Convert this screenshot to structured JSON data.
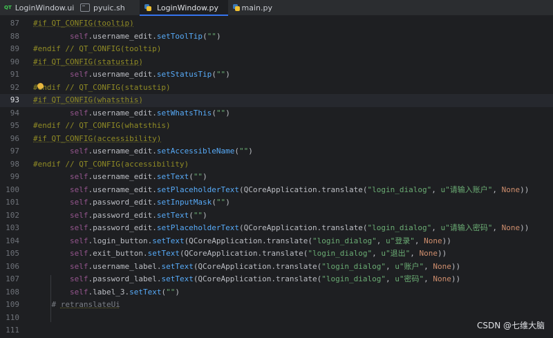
{
  "tabs": [
    {
      "label": "LoginWindow.ui",
      "icon": "qt-ui-icon",
      "icon_text": "QT",
      "active": false
    },
    {
      "label": "pyuic.sh",
      "icon": "shell-script-icon",
      "active": false
    },
    {
      "label": "LoginWindow.py",
      "icon": "python-file-icon",
      "active": true
    },
    {
      "label": "main.py",
      "icon": "python-file-icon",
      "active": false
    }
  ],
  "current_line": "93",
  "lines": [
    {
      "n": "87",
      "tokens": [
        [
          "pps",
          "#if QT_CONFIG(tooltip)"
        ]
      ]
    },
    {
      "n": "88",
      "tokens": [
        [
          "t",
          "        "
        ],
        [
          "kw",
          "self"
        ],
        [
          "t",
          ".username_edit."
        ],
        [
          "fn",
          "setToolTip"
        ],
        [
          "t",
          "("
        ],
        [
          "str",
          "\"\""
        ],
        [
          "t",
          ")"
        ]
      ]
    },
    {
      "n": "89",
      "tokens": [
        [
          "pp",
          "#endif // QT_CONFIG(tooltip)"
        ]
      ]
    },
    {
      "n": "90",
      "tokens": [
        [
          "pps",
          "#if QT_CONFIG(statustip)"
        ]
      ]
    },
    {
      "n": "91",
      "tokens": [
        [
          "t",
          "        "
        ],
        [
          "kw",
          "self"
        ],
        [
          "t",
          ".username_edit."
        ],
        [
          "fn",
          "setStatusTip"
        ],
        [
          "t",
          "("
        ],
        [
          "str",
          "\"\""
        ],
        [
          "t",
          ")"
        ]
      ]
    },
    {
      "n": "92",
      "tokens": [
        [
          "pp",
          "#endif // QT_CONFIG(statustip)"
        ]
      ]
    },
    {
      "n": "93",
      "tokens": [
        [
          "pps",
          "#if QT_CONFIG(whatsthis)"
        ]
      ]
    },
    {
      "n": "94",
      "tokens": [
        [
          "t",
          "        "
        ],
        [
          "kw",
          "self"
        ],
        [
          "t",
          ".username_edit."
        ],
        [
          "fn",
          "setWhatsThis"
        ],
        [
          "t",
          "("
        ],
        [
          "str",
          "\"\""
        ],
        [
          "t",
          ")"
        ]
      ]
    },
    {
      "n": "95",
      "tokens": [
        [
          "pp",
          "#endif // QT_CONFIG(whatsthis)"
        ]
      ]
    },
    {
      "n": "96",
      "tokens": [
        [
          "pps",
          "#if QT_CONFIG(accessibility)"
        ]
      ]
    },
    {
      "n": "97",
      "tokens": [
        [
          "t",
          "        "
        ],
        [
          "kw",
          "self"
        ],
        [
          "t",
          ".username_edit."
        ],
        [
          "fn",
          "setAccessibleName"
        ],
        [
          "t",
          "("
        ],
        [
          "str",
          "\"\""
        ],
        [
          "t",
          ")"
        ]
      ]
    },
    {
      "n": "98",
      "tokens": [
        [
          "pp",
          "#endif // QT_CONFIG(accessibility)"
        ]
      ]
    },
    {
      "n": "99",
      "tokens": [
        [
          "t",
          "        "
        ],
        [
          "kw",
          "self"
        ],
        [
          "t",
          ".username_edit."
        ],
        [
          "fn",
          "setText"
        ],
        [
          "t",
          "("
        ],
        [
          "str",
          "\"\""
        ],
        [
          "t",
          ")"
        ]
      ]
    },
    {
      "n": "100",
      "tokens": [
        [
          "t",
          "        "
        ],
        [
          "kw",
          "self"
        ],
        [
          "t",
          ".username_edit."
        ],
        [
          "fn",
          "setPlaceholderText"
        ],
        [
          "t",
          "(QCoreApplication.translate("
        ],
        [
          "str",
          "\"login_dialog\""
        ],
        [
          "t",
          ", "
        ],
        [
          "str",
          "u\"请输入账户\""
        ],
        [
          "t",
          ", "
        ],
        [
          "none",
          "None"
        ],
        [
          "t",
          "))"
        ]
      ]
    },
    {
      "n": "101",
      "tokens": [
        [
          "t",
          "        "
        ],
        [
          "kw",
          "self"
        ],
        [
          "t",
          ".password_edit."
        ],
        [
          "fn",
          "setInputMask"
        ],
        [
          "t",
          "("
        ],
        [
          "str",
          "\"\""
        ],
        [
          "t",
          ")"
        ]
      ]
    },
    {
      "n": "102",
      "tokens": [
        [
          "t",
          "        "
        ],
        [
          "kw",
          "self"
        ],
        [
          "t",
          ".password_edit."
        ],
        [
          "fn",
          "setText"
        ],
        [
          "t",
          "("
        ],
        [
          "str",
          "\"\""
        ],
        [
          "t",
          ")"
        ]
      ]
    },
    {
      "n": "103",
      "tokens": [
        [
          "t",
          "        "
        ],
        [
          "kw",
          "self"
        ],
        [
          "t",
          ".password_edit."
        ],
        [
          "fn",
          "setPlaceholderText"
        ],
        [
          "t",
          "(QCoreApplication.translate("
        ],
        [
          "str",
          "\"login_dialog\""
        ],
        [
          "t",
          ", "
        ],
        [
          "str",
          "u\"请输入密码\""
        ],
        [
          "t",
          ", "
        ],
        [
          "none",
          "None"
        ],
        [
          "t",
          "))"
        ]
      ]
    },
    {
      "n": "104",
      "tokens": [
        [
          "t",
          "        "
        ],
        [
          "kw",
          "self"
        ],
        [
          "t",
          ".login_button."
        ],
        [
          "fn",
          "setText"
        ],
        [
          "t",
          "(QCoreApplication.translate("
        ],
        [
          "str",
          "\"login_dialog\""
        ],
        [
          "t",
          ", "
        ],
        [
          "str",
          "u\"登录\""
        ],
        [
          "t",
          ", "
        ],
        [
          "none",
          "None"
        ],
        [
          "t",
          "))"
        ]
      ]
    },
    {
      "n": "105",
      "tokens": [
        [
          "t",
          "        "
        ],
        [
          "kw",
          "self"
        ],
        [
          "t",
          ".exit_button."
        ],
        [
          "fn",
          "setText"
        ],
        [
          "t",
          "(QCoreApplication.translate("
        ],
        [
          "str",
          "\"login_dialog\""
        ],
        [
          "t",
          ", "
        ],
        [
          "str",
          "u\"退出\""
        ],
        [
          "t",
          ", "
        ],
        [
          "none",
          "None"
        ],
        [
          "t",
          "))"
        ]
      ]
    },
    {
      "n": "106",
      "tokens": [
        [
          "t",
          "        "
        ],
        [
          "kw",
          "self"
        ],
        [
          "t",
          ".username_label."
        ],
        [
          "fn",
          "setText"
        ],
        [
          "t",
          "(QCoreApplication.translate("
        ],
        [
          "str",
          "\"login_dialog\""
        ],
        [
          "t",
          ", "
        ],
        [
          "str",
          "u\"账户\""
        ],
        [
          "t",
          ", "
        ],
        [
          "none",
          "None"
        ],
        [
          "t",
          "))"
        ]
      ]
    },
    {
      "n": "107",
      "tokens": [
        [
          "t",
          "        "
        ],
        [
          "kw",
          "self"
        ],
        [
          "t",
          ".password_label."
        ],
        [
          "fn",
          "setText"
        ],
        [
          "t",
          "(QCoreApplication.translate("
        ],
        [
          "str",
          "\"login_dialog\""
        ],
        [
          "t",
          ", "
        ],
        [
          "str",
          "u\"密码\""
        ],
        [
          "t",
          ", "
        ],
        [
          "none",
          "None"
        ],
        [
          "t",
          "))"
        ]
      ]
    },
    {
      "n": "108",
      "tokens": [
        [
          "t",
          "        "
        ],
        [
          "kw",
          "self"
        ],
        [
          "t",
          ".label_3."
        ],
        [
          "fn",
          "setText"
        ],
        [
          "t",
          "("
        ],
        [
          "str",
          "\"\""
        ],
        [
          "t",
          ")"
        ]
      ]
    },
    {
      "n": "109",
      "tokens": [
        [
          "t",
          "    "
        ],
        [
          "cmt",
          "# "
        ],
        [
          "cmtu",
          "retranslateUi"
        ]
      ]
    },
    {
      "n": "110",
      "tokens": []
    },
    {
      "n": "111",
      "tokens": []
    }
  ],
  "watermark": "CSDN @七维大脑",
  "colors": {
    "keyword": "#94558d",
    "function": "#57aaf7",
    "string": "#6aab73",
    "none": "#cf8e6d",
    "preprocessor": "#908b25",
    "comment": "#7a7e85",
    "accent": "#3574f0"
  }
}
